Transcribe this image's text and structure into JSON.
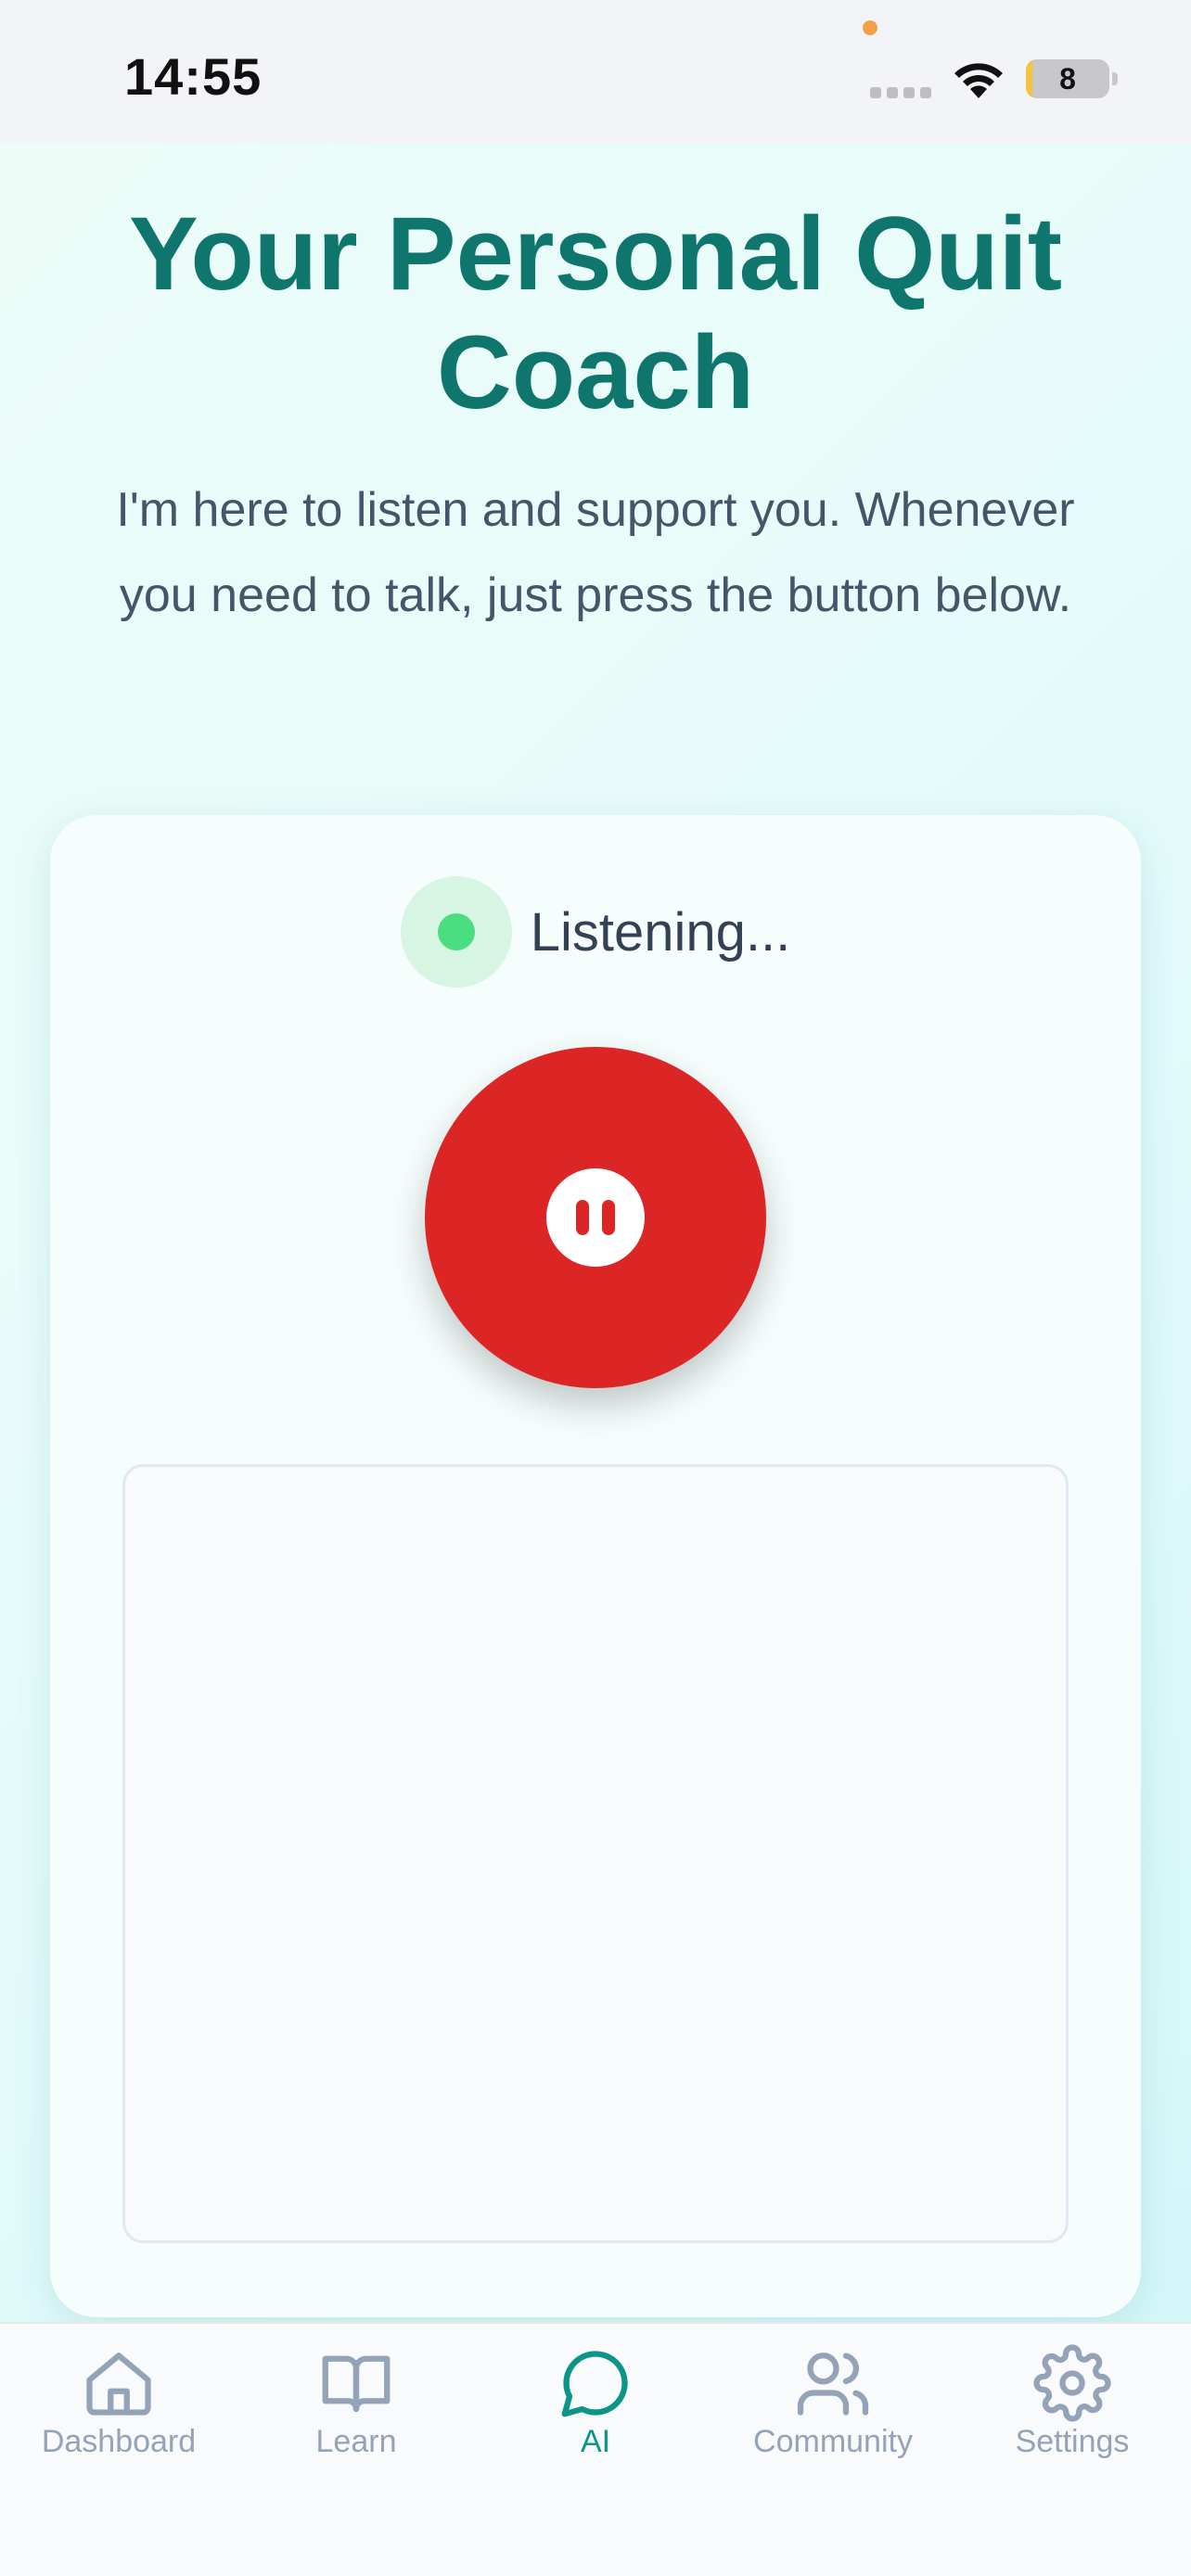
{
  "status_bar": {
    "time": "14:55",
    "battery_level": "8",
    "battery_fraction": 0.08,
    "icons": [
      "signal-icon",
      "wifi-icon",
      "battery-icon"
    ]
  },
  "header": {
    "title": "Your Personal Quit Coach",
    "subtitle": "I'm here to listen and support you. Whenever you need to talk, just press the button below."
  },
  "coach_card": {
    "status_text": "Listening...",
    "status_color": "#4ade80",
    "mic_button_color": "#dc2626",
    "mic_button_icon": "pause-icon",
    "transcript": ""
  },
  "nav": {
    "active_color": "#0d9488",
    "inactive_color": "#94a3b8",
    "items": [
      {
        "label": "Dashboard",
        "icon": "home-icon",
        "active": false
      },
      {
        "label": "Learn",
        "icon": "book-icon",
        "active": false
      },
      {
        "label": "AI",
        "icon": "chat-bubble-icon",
        "active": true
      },
      {
        "label": "Community",
        "icon": "users-icon",
        "active": false
      },
      {
        "label": "Settings",
        "icon": "gear-icon",
        "active": false
      }
    ]
  }
}
